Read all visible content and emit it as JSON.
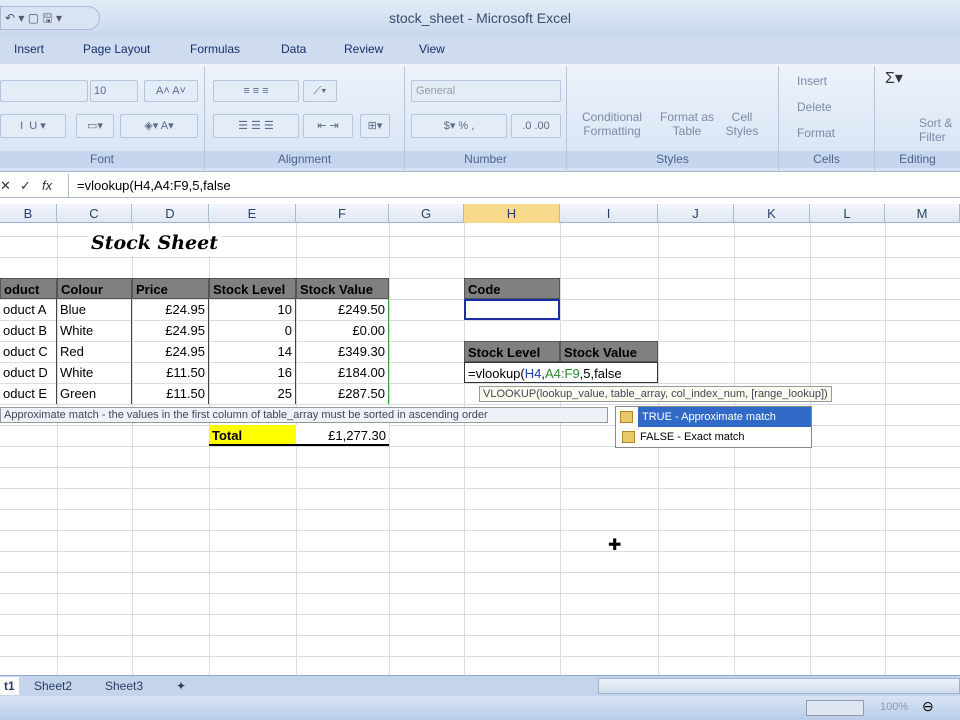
{
  "window": {
    "title": "stock_sheet - Microsoft Excel"
  },
  "ribbon_tabs": [
    "Insert",
    "Page Layout",
    "Formulas",
    "Data",
    "Review",
    "View"
  ],
  "ribbon": {
    "font_size": "10",
    "number_format": "General",
    "groups": [
      "Font",
      "Alignment",
      "Number",
      "Styles",
      "Cells",
      "Editing"
    ],
    "styles": {
      "conditional": "Conditional Formatting",
      "format_table": "Format as Table",
      "cell_styles": "Cell Styles"
    },
    "cells": {
      "insert": "Insert",
      "delete": "Delete",
      "format": "Format"
    },
    "editing": {
      "sort": "Sort & Filter"
    }
  },
  "formula_bar": {
    "cancel": "✕",
    "enter": "✓",
    "fx": "fx",
    "value": "=vlookup(H4,A4:F9,5,false"
  },
  "columns": [
    "B",
    "C",
    "D",
    "E",
    "F",
    "G",
    "H",
    "I",
    "J",
    "K",
    "L",
    "M"
  ],
  "selected_column": "H",
  "sheet": {
    "title": "Stock Sheet",
    "headers": [
      "oduct",
      "Colour",
      "Price",
      "Stock Level",
      "Stock Value"
    ],
    "rows": [
      [
        "oduct A",
        "Blue",
        "£24.95",
        "10",
        "£249.50"
      ],
      [
        "oduct B",
        "White",
        "£24.95",
        "0",
        "£0.00"
      ],
      [
        "oduct C",
        "Red",
        "£24.95",
        "14",
        "£349.30"
      ],
      [
        "oduct D",
        "White",
        "£11.50",
        "16",
        "£184.00"
      ],
      [
        "oduct E",
        "Green",
        "£11.50",
        "25",
        "£287.50"
      ]
    ],
    "total_label": "Total",
    "total_value": "£1,277.30",
    "code_header": "Code",
    "code_value": "",
    "lookup_headers": [
      "Stock Level",
      "Stock Value"
    ],
    "editing_formula": {
      "p1": "=vlookup(",
      "p2": "H4",
      "p3": ",",
      "p4": "A4:F9",
      "p5": ",5,false"
    }
  },
  "tooltips": {
    "syntax": "VLOOKUP(lookup_value, table_array, col_index_num, [range_lookup])",
    "hint": "Approximate match - the values in the first column of table_array must be sorted in ascending order"
  },
  "autocomplete": [
    "TRUE - Approximate match",
    "FALSE - Exact match"
  ],
  "sheet_tabs": [
    "t1",
    "Sheet2",
    "Sheet3"
  ],
  "status": {
    "zoom": "100%"
  }
}
